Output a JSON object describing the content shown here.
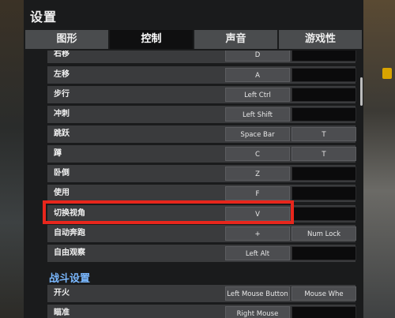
{
  "window": {
    "title": "设置"
  },
  "tabs": [
    {
      "label": "图形",
      "active": false
    },
    {
      "label": "控制",
      "active": true
    },
    {
      "label": "声音",
      "active": false
    },
    {
      "label": "游戏性",
      "active": false
    }
  ],
  "controls": [
    {
      "label": "右移",
      "primary": "D",
      "secondary": ""
    },
    {
      "label": "左移",
      "primary": "A",
      "secondary": ""
    },
    {
      "label": "步行",
      "primary": "Left Ctrl",
      "secondary": ""
    },
    {
      "label": "冲刺",
      "primary": "Left Shift",
      "secondary": ""
    },
    {
      "label": "跳跃",
      "primary": "Space Bar",
      "secondary": "T"
    },
    {
      "label": "蹲",
      "primary": "C",
      "secondary": "T"
    },
    {
      "label": "卧倒",
      "primary": "Z",
      "secondary": ""
    },
    {
      "label": "使用",
      "primary": "F",
      "secondary": ""
    },
    {
      "label": "切换视角",
      "primary": "V",
      "secondary": ""
    },
    {
      "label": "自动奔跑",
      "primary": "+",
      "secondary": "Num Lock"
    },
    {
      "label": "自由观察",
      "primary": "Left Alt",
      "secondary": ""
    }
  ],
  "combat_section": {
    "title": "战斗设置"
  },
  "combat_controls": [
    {
      "label": "开火",
      "primary": "Left Mouse Button",
      "secondary": "Mouse Whe"
    },
    {
      "label": "瞄准",
      "primary": "Right Mouse Button",
      "secondary": ""
    }
  ],
  "highlight_color": "#e8261c",
  "accent_color": "#7ab8ff"
}
